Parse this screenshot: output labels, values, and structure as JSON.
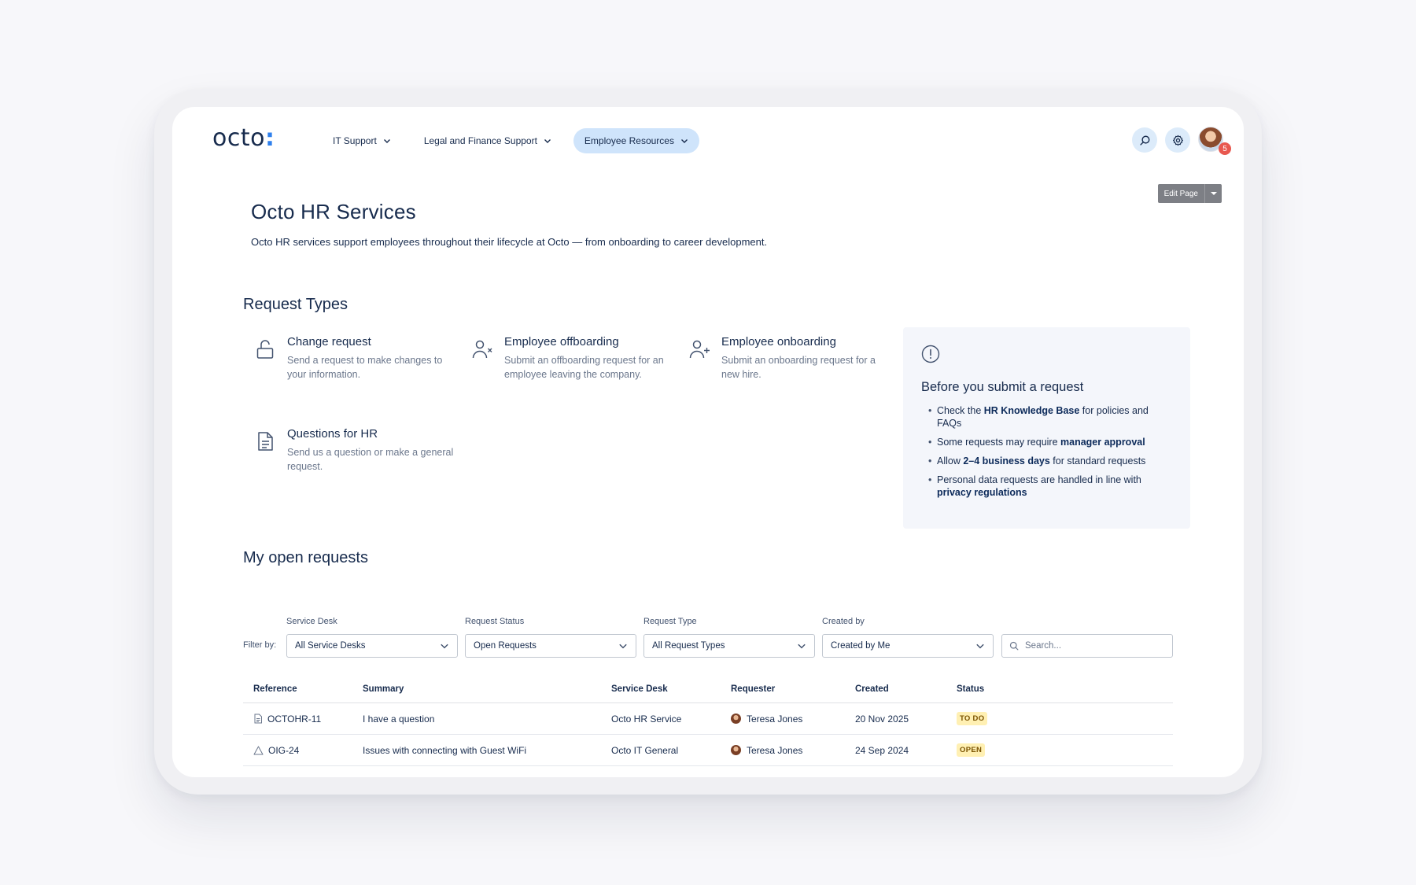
{
  "brand": {
    "name": "octo",
    "mark": ":"
  },
  "nav": {
    "items": [
      {
        "label": "IT Support",
        "active": false
      },
      {
        "label": "Legal and Finance Support",
        "active": false
      },
      {
        "label": "Employee Resources",
        "active": true
      }
    ],
    "notification_count": "5"
  },
  "edit_page": {
    "label": "Edit Page"
  },
  "header": {
    "title": "Octo HR Services",
    "description": "Octo HR services support employees throughout their lifecycle at Octo — from onboarding to career development."
  },
  "request_types": {
    "title": "Request Types",
    "items": [
      {
        "title": "Change request",
        "description": "Send a request to make changes to your information.",
        "icon": "unlock-icon"
      },
      {
        "title": "Employee offboarding",
        "description": "Submit an offboarding request for an employee leaving the company.",
        "icon": "user-remove-icon"
      },
      {
        "title": "Employee onboarding",
        "description": "Submit an onboarding request for a new hire.",
        "icon": "user-add-icon"
      },
      {
        "title": "Questions for HR",
        "description": "Send us a question or make a general request.",
        "icon": "document-icon"
      }
    ]
  },
  "info_box": {
    "title": "Before you submit a request",
    "items": [
      {
        "pre": "Check the ",
        "bold": "HR Knowledge Base",
        "post": " for policies and FAQs"
      },
      {
        "pre": "Some requests may require ",
        "bold": "manager approval",
        "post": ""
      },
      {
        "pre": "Allow ",
        "bold": "2–4 business days",
        "post": " for standard requests"
      },
      {
        "pre": "Personal data requests are handled in line with ",
        "bold": "privacy regulations",
        "post": ""
      }
    ]
  },
  "open_requests": {
    "title": "My open requests",
    "filter_by": "Filter by:",
    "filters": [
      {
        "label": "Service Desk",
        "value": "All Service Desks"
      },
      {
        "label": "Request Status",
        "value": "Open Requests"
      },
      {
        "label": "Request Type",
        "value": "All Request Types"
      },
      {
        "label": "Created by",
        "value": "Created by Me"
      }
    ],
    "search_placeholder": "Search...",
    "columns": [
      "Reference",
      "Summary",
      "Service Desk",
      "Requester",
      "Created",
      "Status"
    ],
    "rows": [
      {
        "reference": "OCTOHR-11",
        "icon": "document-icon",
        "summary": "I have a question",
        "service_desk": "Octo HR Service",
        "requester": "Teresa Jones",
        "created": "20 Nov 2025",
        "status": "TO DO"
      },
      {
        "reference": "OIG-24",
        "icon": "warning-icon",
        "summary": "Issues with connecting with Guest WiFi",
        "service_desk": "Octo IT General",
        "requester": "Teresa Jones",
        "created": "24 Sep 2024",
        "status": "OPEN"
      }
    ]
  }
}
